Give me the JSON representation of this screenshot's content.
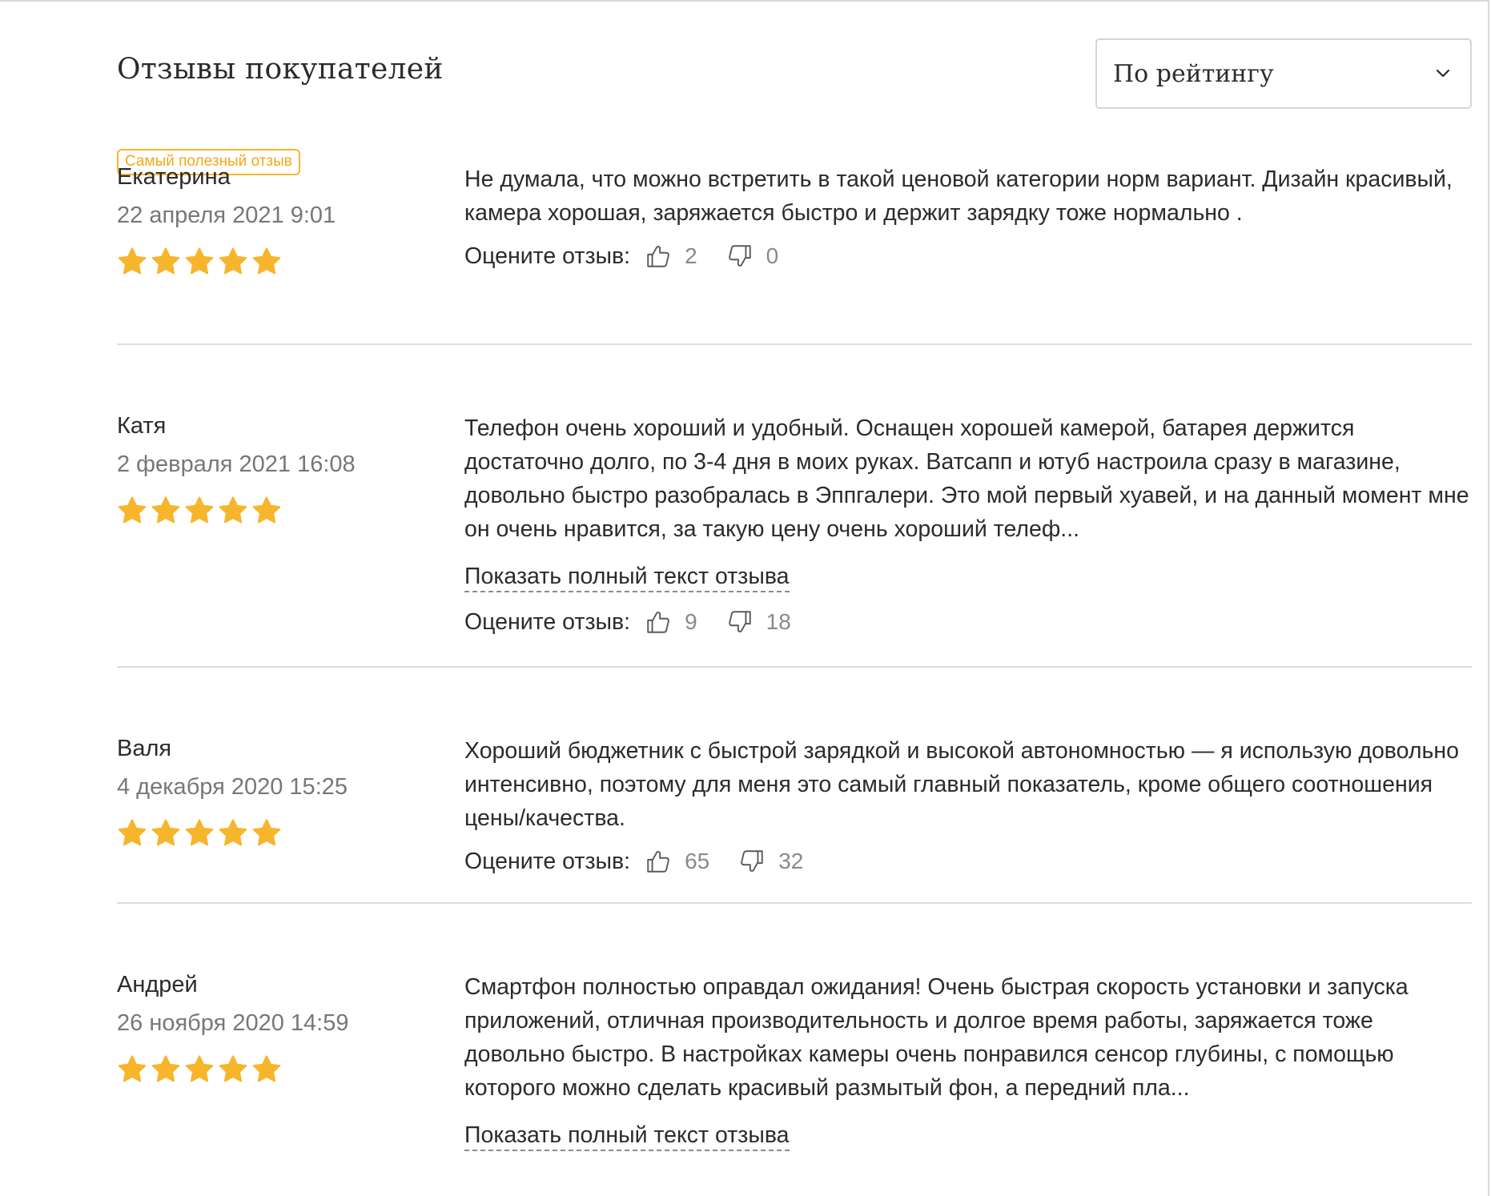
{
  "header": {
    "title": "Отзывы покупателей",
    "sort_value": "По рейтингу",
    "sort_icon": "chevron-down-icon"
  },
  "colors": {
    "star": "#f7b52c",
    "badge": "#f2a81b",
    "muted": "#777777",
    "divider": "#dcdcdc"
  },
  "rate_label": "Оцените отзыв:",
  "show_more_label": "Показать полный текст отзыва",
  "reviews": [
    {
      "badge": "Самый полезный отзыв",
      "author": "Екатерина",
      "date": "22 апреля 2021 9:01",
      "stars": 5,
      "text": "Не думала, что можно встретить в такой ценовой категории норм вариант. Дизайн красивый, камера хорошая, заряжается быстро и держит зарядку тоже нормально .",
      "likes": "2",
      "dislikes": "0"
    },
    {
      "author": "Катя",
      "date": "2 февраля 2021 16:08",
      "stars": 5,
      "text": "Телефон очень хороший и удобный. Оснащен хорошей камерой, батарея держится достаточно долго, по 3-4 дня в моих руках. Ватсапп и ютуб настроила сразу в магазине, довольно быстро разобралась в Эппгалери. Это мой первый хуавей, и на данный момент мне он очень нравится, за такую цену очень хороший телеф...",
      "likes": "9",
      "dislikes": "18"
    },
    {
      "author": "Валя",
      "date": "4 декабря 2020 15:25",
      "stars": 5,
      "text": "Хороший бюджетник с быстрой зарядкой и высокой автономностью — я использую довольно интенсивно, поэтому для меня это самый главный показатель, кроме общего соотношения цены/качества.",
      "likes": "65",
      "dislikes": "32"
    },
    {
      "author": "Андрей",
      "date": "26 ноября 2020 14:59",
      "stars": 5,
      "text": "Смартфон полностью оправдал ожидания! Очень быстрая скорость установки и запуска приложений, отличная производительность и долгое время работы, заряжается тоже довольно быстро. В настройках камеры очень понравился сенсор глубины, с помощью которого можно сделать красивый размытый фон, а передний пла..."
    }
  ]
}
